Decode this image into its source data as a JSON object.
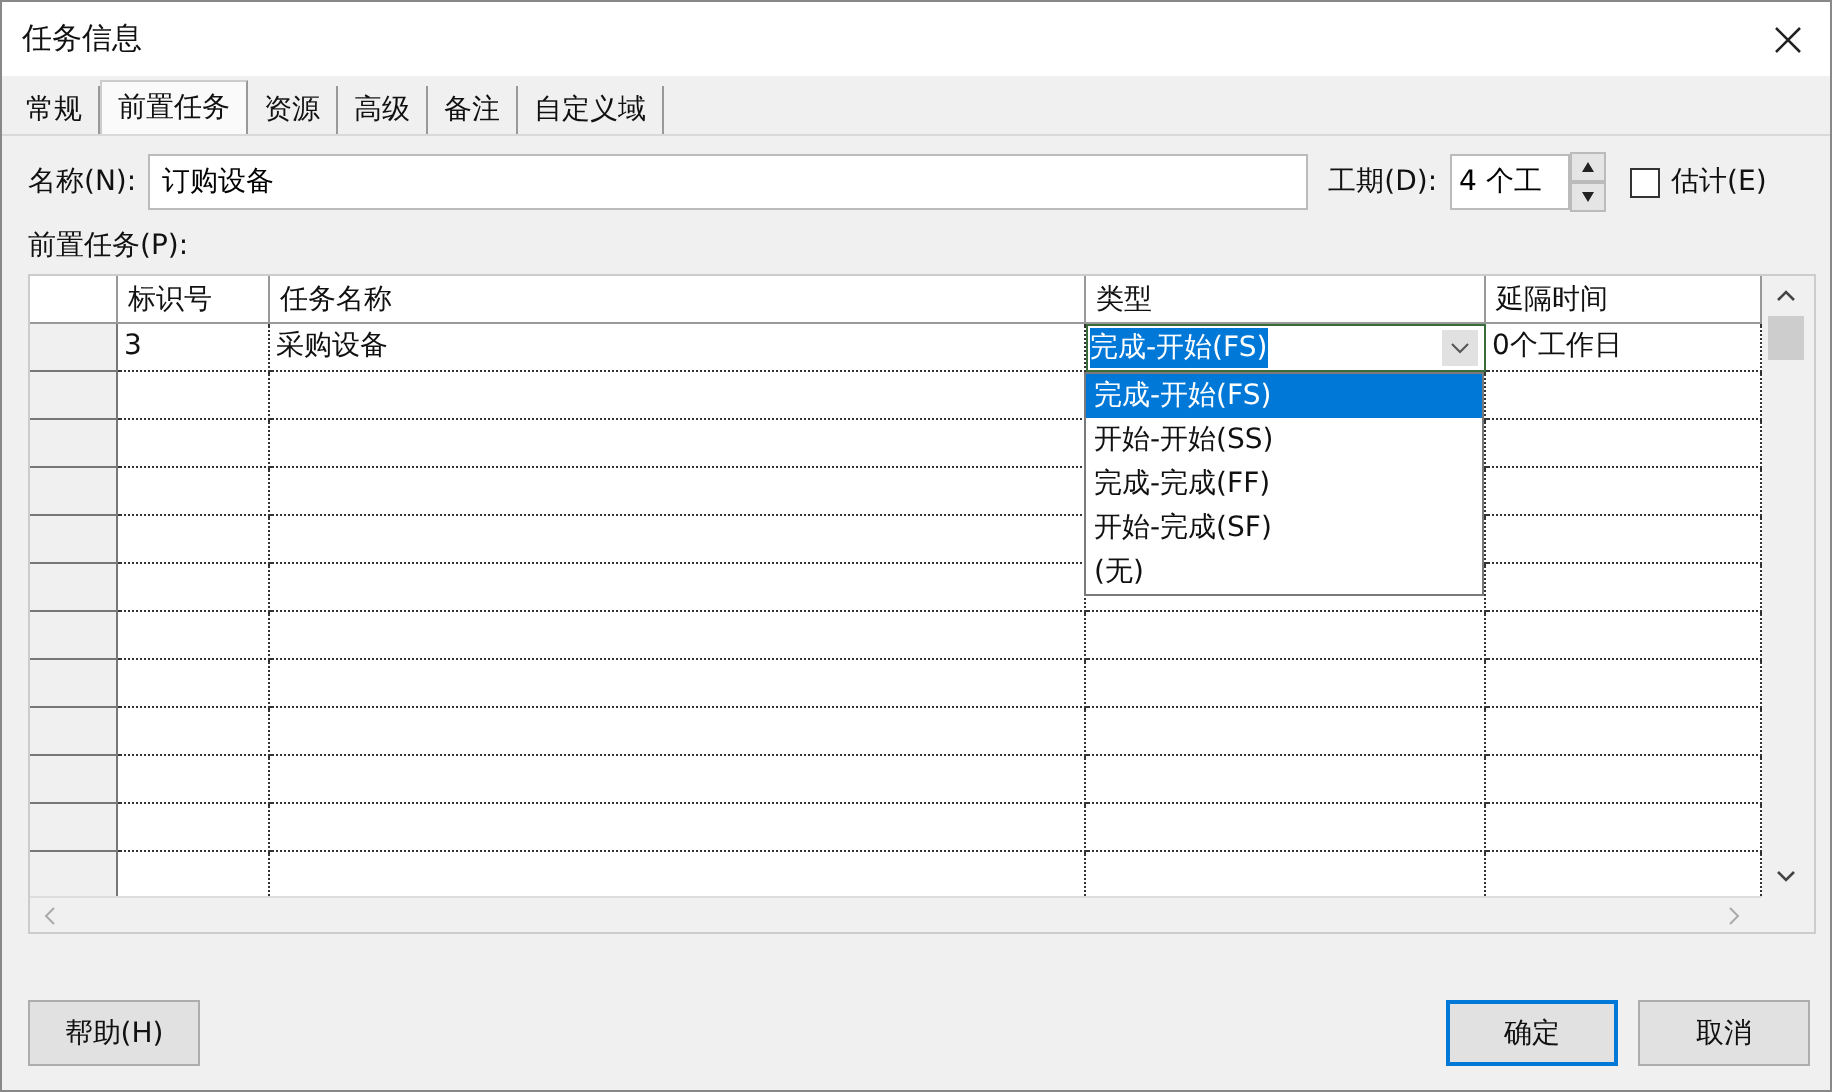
{
  "window": {
    "title": "任务信息"
  },
  "tabs": [
    {
      "label": "常规",
      "selected": false
    },
    {
      "label": "前置任务",
      "selected": true
    },
    {
      "label": "资源",
      "selected": false
    },
    {
      "label": "高级",
      "selected": false
    },
    {
      "label": "备注",
      "selected": false
    },
    {
      "label": "自定义域",
      "selected": false
    }
  ],
  "name_field": {
    "label": "名称(N):",
    "value": "订购设备"
  },
  "duration_field": {
    "label": "工期(D):",
    "value": "4 个工"
  },
  "estimate_checkbox": {
    "label": "估计(E)",
    "checked": false
  },
  "predecessors": {
    "label": "前置任务(P):",
    "columns": [
      "标识号",
      "任务名称",
      "类型",
      "延隔时间"
    ],
    "rows": [
      {
        "id": "3",
        "name": "采购设备",
        "type": "完成-开始(FS)",
        "lag": "0个工作日"
      }
    ]
  },
  "type_dropdown": {
    "options": [
      {
        "label": "完成-开始(FS)",
        "selected": true
      },
      {
        "label": "开始-开始(SS)",
        "selected": false
      },
      {
        "label": "完成-完成(FF)",
        "selected": false
      },
      {
        "label": "开始-完成(SF)",
        "selected": false
      },
      {
        "label": "(无)",
        "selected": false
      }
    ]
  },
  "buttons": {
    "help": "帮助(H)",
    "ok": "确定",
    "cancel": "取消"
  }
}
